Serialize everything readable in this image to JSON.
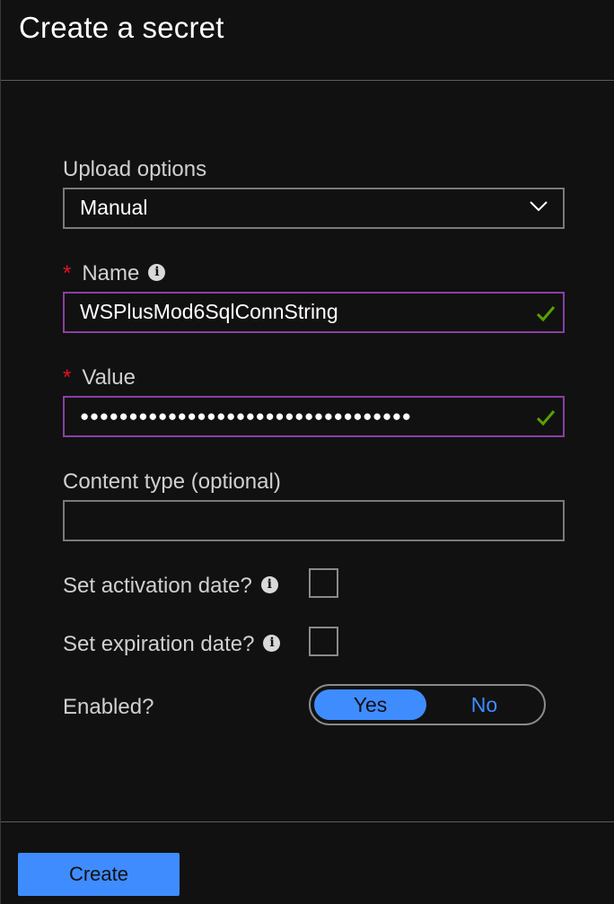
{
  "header": {
    "title": "Create a secret"
  },
  "form": {
    "upload_options": {
      "label": "Upload options",
      "selected": "Manual",
      "icon": "chevron-down-icon"
    },
    "name": {
      "required_mark": "*",
      "label": "Name",
      "value": "WSPlusMod6SqlConnString",
      "valid": true
    },
    "value": {
      "required_mark": "*",
      "label": "Value",
      "masked_value": "●●●●●●●●●●●●●●●●●●●●●●●●●●●●●●●●●●",
      "valid": true
    },
    "content_type": {
      "label": "Content type (optional)",
      "value": ""
    },
    "activation_date": {
      "label": "Set activation date?",
      "checked": false
    },
    "expiration_date": {
      "label": "Set expiration date?",
      "checked": false
    },
    "enabled": {
      "label": "Enabled?",
      "options": [
        "Yes",
        "No"
      ],
      "selected": "Yes"
    }
  },
  "footer": {
    "create_label": "Create"
  },
  "colors": {
    "background": "#111111",
    "accent": "#3f8cff",
    "valid_border": "#8a3fa6",
    "check": "#57a300",
    "required": "#e81123"
  }
}
